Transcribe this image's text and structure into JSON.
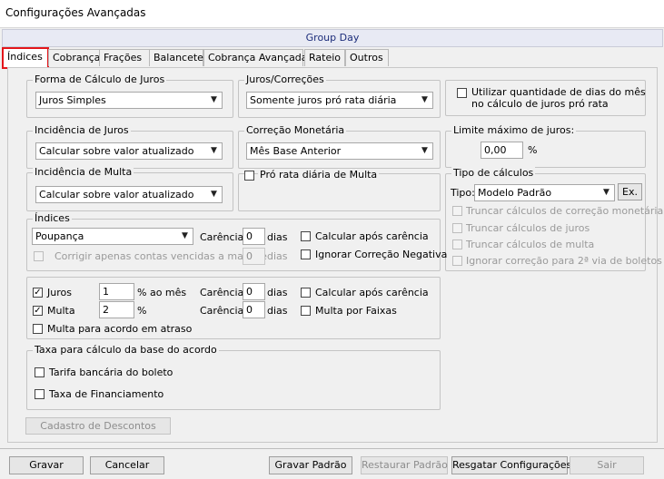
{
  "window": {
    "title": "Configurações Avançadas"
  },
  "group_label": "Group Day",
  "tabs": [
    "Índices",
    "Cobrança",
    "Frações",
    "Balancete",
    "Cobrança Avançada",
    "Rateio",
    "Outros"
  ],
  "forma_calculo": {
    "legend": "Forma de Cálculo de Juros",
    "value": "Juros Simples"
  },
  "juros_correcoes": {
    "legend": "Juros/Correções",
    "value": "Somente juros pró rata diária"
  },
  "utilizar_qtd_dias": {
    "line1": "Utilizar quantidade de dias do mês",
    "line2": "no cálculo de juros pró rata",
    "checked": false
  },
  "incidencia_juros": {
    "legend": "Incidência de Juros",
    "value": "Calcular sobre valor atualizado"
  },
  "correcao_monetaria": {
    "legend": "Correção Monetária",
    "value": "Mês Base Anterior"
  },
  "limite_juros": {
    "legend": "Limite máximo de juros:",
    "value": "0,00",
    "unit": "%"
  },
  "incidencia_multa": {
    "legend": "Incidência de Multa",
    "value": "Calcular sobre valor atualizado"
  },
  "pro_rata_multa": {
    "label": "Pró rata diária de Multa",
    "checked": false
  },
  "tipo_calculos": {
    "legend": "Tipo de cálculos",
    "tipo_label": "Tipo:",
    "tipo_value": "Modelo Padrão",
    "ex_button": "Ex.",
    "options": [
      "Truncar cálculos de correção monetária",
      "Truncar cálculos de juros",
      "Truncar cálculos de multa",
      "Ignorar correção para 2ª via de boletos"
    ]
  },
  "indices": {
    "legend": "Índices",
    "value": "Poupança",
    "carencia_label": "Carência:",
    "carencia_value": "0",
    "dias_label": "dias",
    "calcular_apos": "Calcular após carência",
    "ignorar_negativa": "Ignorar Correção Negativa",
    "corrigir_label": "Corrigir apenas contas vencidas a mais de",
    "corrigir_value": "0",
    "corrigir_dias": "dias"
  },
  "juros_multa": {
    "juros_label": "Juros",
    "juros_checked": true,
    "juros_value": "1",
    "juros_unit": "% ao mês",
    "multa_label": "Multa",
    "multa_checked": true,
    "multa_value": "2",
    "multa_unit": "%",
    "carencia_label": "Carência:",
    "juros_carencia": "0",
    "multa_carencia": "0",
    "dias_label": "dias",
    "calcular_apos": "Calcular após carência",
    "multa_faixas": "Multa por Faixas",
    "multa_acordo": "Multa para acordo em atraso"
  },
  "taxa": {
    "legend": "Taxa para cálculo da base do acordo",
    "tarifa": "Tarifa bancária do boleto",
    "financiamento": "Taxa de Financiamento"
  },
  "cadastro_descontos": "Cadastro de Descontos",
  "buttons": {
    "gravar": "Gravar",
    "cancelar": "Cancelar",
    "gravar_padrao": "Gravar Padrão",
    "restaurar_padrao": "Restaurar Padrão",
    "resgatar": "Resgatar Configurações",
    "sair": "Sair"
  }
}
